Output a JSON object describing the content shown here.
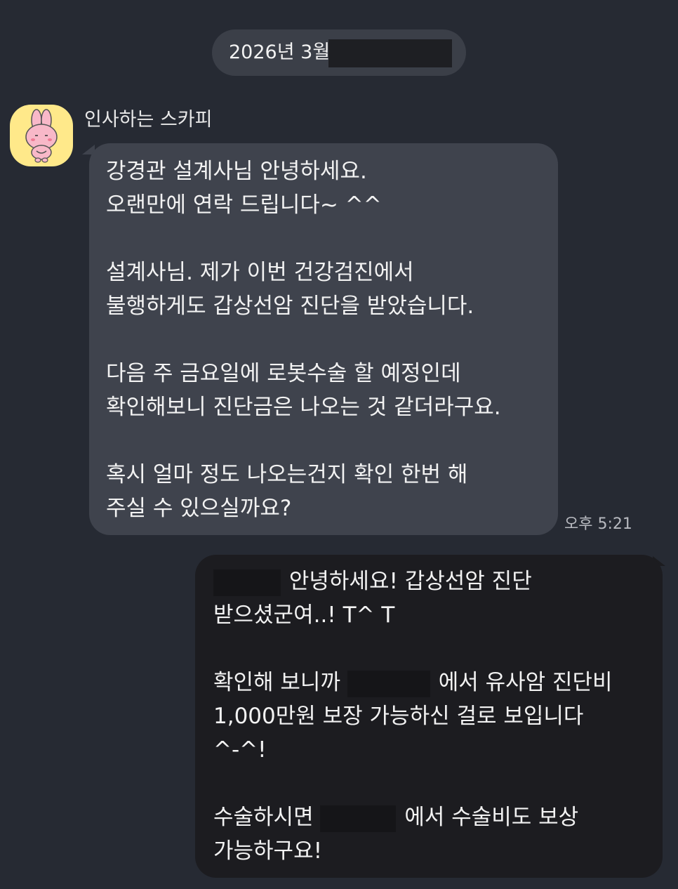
{
  "date_divider": {
    "label": "2026년 3월"
  },
  "incoming": {
    "sender_name": "인사하는 스카피",
    "time": "오후 5:21",
    "lines": [
      "강경관 설계사님 안녕하세요.",
      "오랜만에 연락 드립니다~ ^^",
      "",
      "설계사님. 제가 이번 건강검진에서",
      "불행하게도 갑상선암 진단을 받았습니다.",
      "",
      "다음 주 금요일에 로봇수술 할 예정인데",
      "확인해보니 진단금은 나오는 것 같더라구요.",
      "",
      "혹시 얼마 정도 나오는건지 확인 한번 해",
      "주실 수 있으실까요?"
    ]
  },
  "outgoing": {
    "line1_suffix": "안녕하세요! 갑상선암 진단",
    "line2": "받으셨군여..! T^ T",
    "line4_prefix": "확인해 보니까",
    "line4_suffix": "에서 유사암 진단비",
    "line5": "1,000만원 보장 가능하신 걸로 보입니다",
    "line6": "^-^!",
    "line8_prefix": "수술하시면",
    "line8_suffix": "에서 수술비도 보상",
    "line9": "가능하구요!"
  },
  "colors": {
    "background": "#262a33",
    "incoming_bubble": "#3f434d",
    "outgoing_bubble": "#1c1c20",
    "avatar_bg": "#ffe98a",
    "redaction": "#151518"
  },
  "icons": {
    "avatar": "pink-rabbit-sticker-icon"
  }
}
